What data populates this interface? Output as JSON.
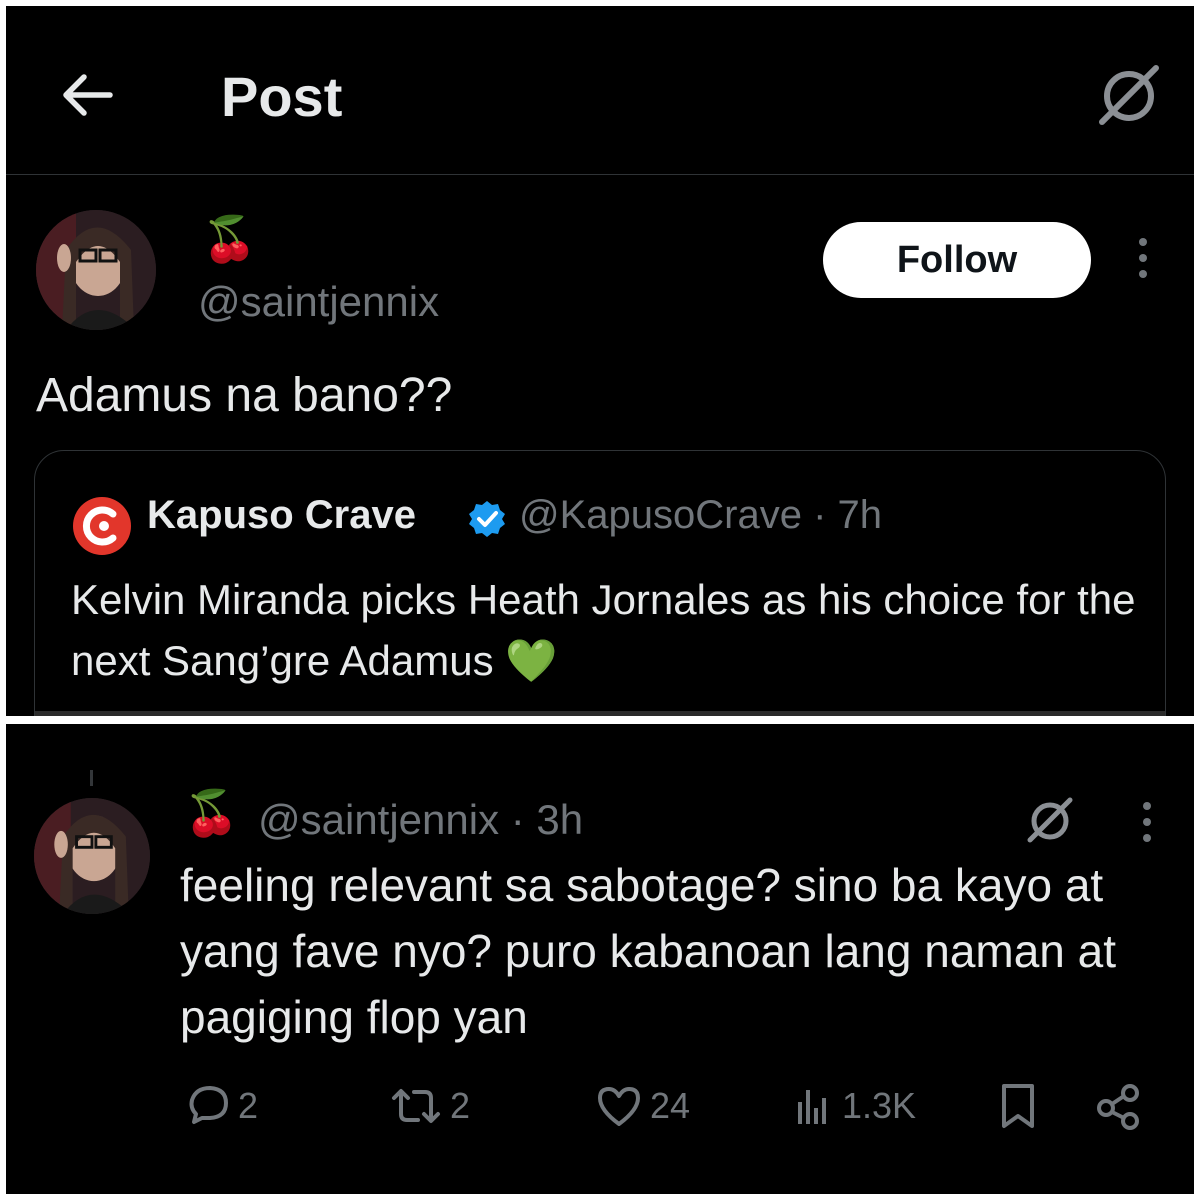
{
  "header": {
    "title": "Post",
    "back_icon": "arrow-left-icon",
    "grok_icon": "grok-icon"
  },
  "post": {
    "author_name": "🍒",
    "handle": "@saintjennix",
    "follow_label": "Follow",
    "text": "Adamus na bano??"
  },
  "quote": {
    "name": "Kapuso Crave",
    "handle_time": "@KapusoCrave · 7h",
    "text": "Kelvin Miranda picks Heath Jornales as his choice for the next Sang’gre Adamus 💚",
    "logo_color": "#e2362b",
    "verified_color": "#1d9bf0"
  },
  "reply": {
    "author_name": "🍒",
    "handle_time": "@saintjennix · 3h",
    "text": "feeling relevant sa sabotage? sino ba kayo at yang fave nyo? puro kabanoan lang naman at pagiging flop yan",
    "actions": {
      "replies": "2",
      "reposts": "2",
      "likes": "24",
      "views": "1.3K"
    }
  },
  "colors": {
    "background": "#000000",
    "text": "#e7e9ea",
    "muted": "#71767b",
    "frame": "#ffffff"
  }
}
